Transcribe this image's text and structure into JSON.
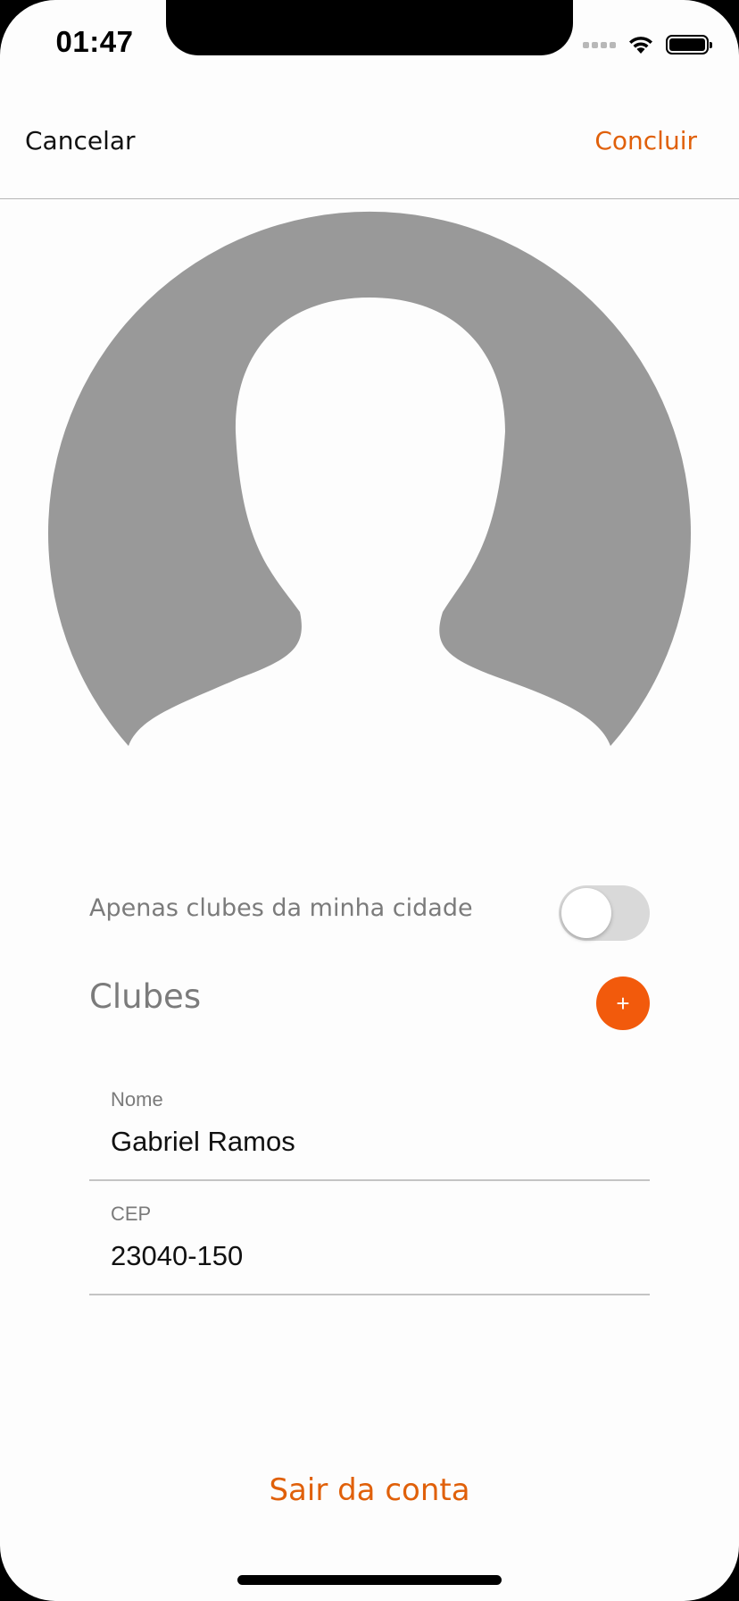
{
  "status_bar": {
    "time": "01:47"
  },
  "nav": {
    "cancel_label": "Cancelar",
    "done_label": "Concluir"
  },
  "avatar": {
    "icon": "person-placeholder-icon"
  },
  "filter": {
    "label": "Apenas clubes da minha cidade",
    "enabled": false
  },
  "clubs": {
    "title": "Clubes",
    "add_symbol": "+"
  },
  "form": {
    "name": {
      "label": "Nome",
      "value": "Gabriel Ramos"
    },
    "cep": {
      "label": "CEP",
      "value": "23040-150"
    }
  },
  "logout_label": "Sair da conta",
  "colors": {
    "accent": "#e0600a",
    "add_button": "#f25a0c",
    "avatar_gray": "#999999"
  }
}
